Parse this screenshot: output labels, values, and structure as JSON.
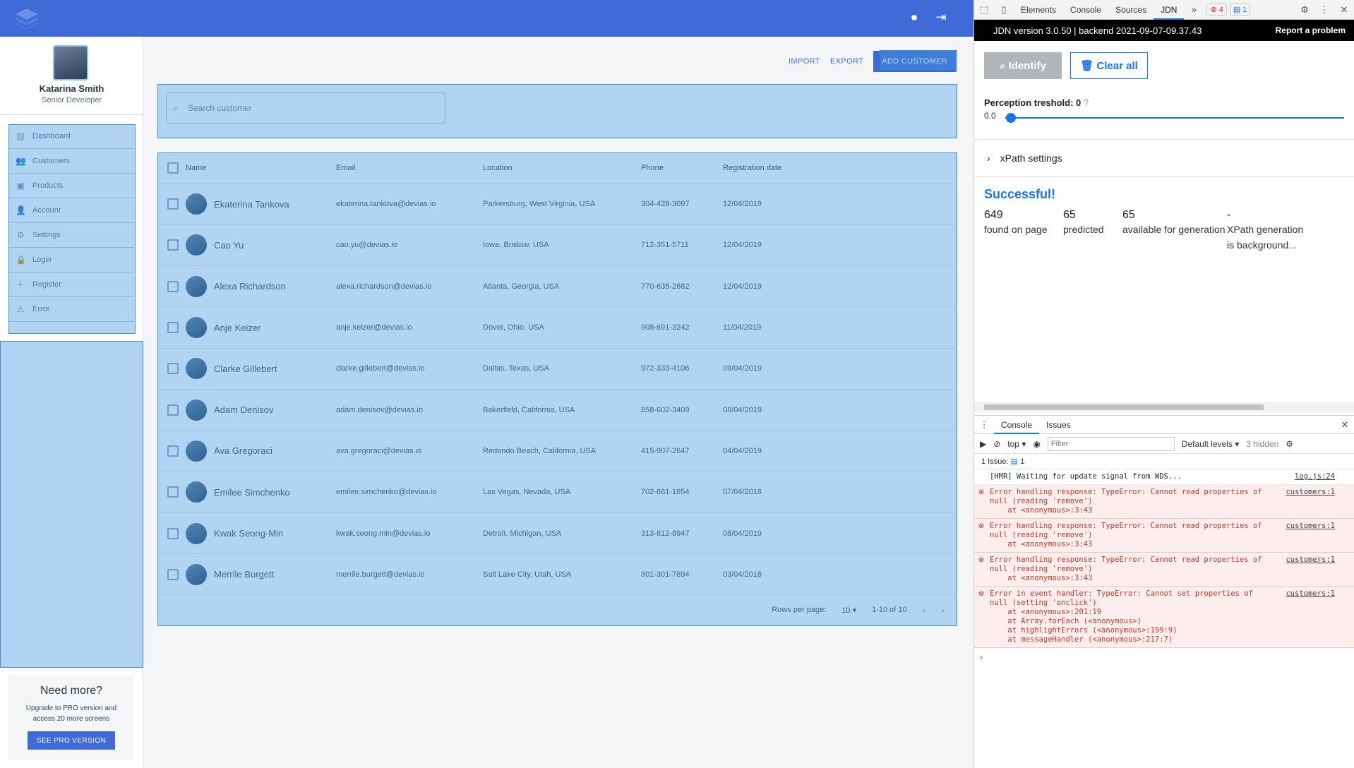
{
  "sidebar": {
    "profile": {
      "name": "Katarina Smith",
      "role": "Senior Developer"
    },
    "items": [
      {
        "label": "Dashboard",
        "icon": "chart-icon"
      },
      {
        "label": "Customers",
        "icon": "users-icon"
      },
      {
        "label": "Products",
        "icon": "bag-icon"
      },
      {
        "label": "Account",
        "icon": "user-icon"
      },
      {
        "label": "Settings",
        "icon": "gear-icon"
      },
      {
        "label": "Login",
        "icon": "lock-icon"
      },
      {
        "label": "Register",
        "icon": "user-plus-icon"
      },
      {
        "label": "Error",
        "icon": "alert-icon"
      }
    ],
    "promo": {
      "title": "Need more?",
      "text": "Upgrade to PRO version and access 20 more screens",
      "button": "SEE PRO VERSION"
    }
  },
  "main": {
    "actions": {
      "import": "IMPORT",
      "export": "EXPORT",
      "add": "ADD CUSTOMER"
    },
    "search": {
      "placeholder": "Search customer"
    },
    "table": {
      "headers": {
        "name": "Name",
        "email": "Email",
        "location": "Location",
        "phone": "Phone",
        "date": "Registration date"
      },
      "rows": [
        {
          "name": "Ekaterina Tankova",
          "email": "ekaterina.tankova@devias.io",
          "location": "Parkersburg, West Virginia, USA",
          "phone": "304-428-3097",
          "date": "12/04/2019"
        },
        {
          "name": "Cao Yu",
          "email": "cao.yu@devias.io",
          "location": "Iowa, Bristow, USA",
          "phone": "712-351-5711",
          "date": "12/04/2019"
        },
        {
          "name": "Alexa Richardson",
          "email": "alexa.richardson@devias.io",
          "location": "Atlanta, Georgia, USA",
          "phone": "770-635-2682",
          "date": "12/04/2019"
        },
        {
          "name": "Anje Keizer",
          "email": "anje.keizer@devias.io",
          "location": "Dover, Ohio, USA",
          "phone": "908-691-3242",
          "date": "11/04/2019"
        },
        {
          "name": "Clarke Gillebert",
          "email": "clarke.gillebert@devias.io",
          "location": "Dallas, Texas, USA",
          "phone": "972-333-4106",
          "date": "09/04/2019"
        },
        {
          "name": "Adam Denisov",
          "email": "adam.denisov@devias.io",
          "location": "Bakerfield, California, USA",
          "phone": "858-602-3409",
          "date": "08/04/2019"
        },
        {
          "name": "Ava Gregoraci",
          "email": "ava.gregoraci@devias.io",
          "location": "Redondo Beach, California, USA",
          "phone": "415-907-2647",
          "date": "04/04/2019"
        },
        {
          "name": "Emilee Simchenko",
          "email": "emilee.simchenko@devias.io",
          "location": "Las Vegas, Nevada, USA",
          "phone": "702-661-1654",
          "date": "07/04/2018"
        },
        {
          "name": "Kwak Seong-Min",
          "email": "kwak.seong.min@devias.io",
          "location": "Detroit, Michigan, USA",
          "phone": "313-812-8947",
          "date": "08/04/2019"
        },
        {
          "name": "Merrile Burgett",
          "email": "merrile.burgett@devias.io",
          "location": "Salt Lake City, Utah, USA",
          "phone": "801-301-7894",
          "date": "03/04/2018"
        }
      ],
      "pagination": {
        "rows_label": "Rows per page:",
        "rows_value": "10",
        "range": "1-10 of 10"
      }
    }
  },
  "devtools": {
    "tabs": [
      "Elements",
      "Console",
      "Sources",
      "JDN"
    ],
    "error_count": "4",
    "message_count": "1",
    "jdn": {
      "version": "JDN version 3.0.50 | backend 2021-09-07-09.37.43",
      "report": "Report a problem",
      "identify": "Identify",
      "clear": "Clear all",
      "perception_label": "Perception treshold: 0",
      "perception_value": "0.0",
      "perception_fraction": 0.0,
      "xpath": "xPath settings",
      "success": "Successful!",
      "stats": [
        {
          "n": "649",
          "t": "found on page"
        },
        {
          "n": "65",
          "t": "predicted"
        },
        {
          "n": "65",
          "t": "available for generation"
        },
        {
          "n": "-",
          "t": "XPath generation is background..."
        }
      ]
    },
    "console": {
      "tabs": [
        "Console",
        "Issues"
      ],
      "context": "top",
      "filter_placeholder": "Filter",
      "levels": "Default levels",
      "hidden": "3 hidden",
      "issues": "1 Issue:",
      "issues_count": "1",
      "logs": [
        {
          "type": "info",
          "text": "[HMR] Waiting for update signal from WDS...",
          "src": "log.js:24"
        },
        {
          "type": "error",
          "text": "Error handling response: TypeError: Cannot read properties of\nnull (reading 'remove')\n    at <anonymous>:3:43",
          "src": "customers:1"
        },
        {
          "type": "error",
          "text": "Error handling response: TypeError: Cannot read properties of\nnull (reading 'remove')\n    at <anonymous>:3:43",
          "src": "customers:1"
        },
        {
          "type": "error",
          "text": "Error handling response: TypeError: Cannot read properties of\nnull (reading 'remove')\n    at <anonymous>:3:43",
          "src": "customers:1"
        },
        {
          "type": "error",
          "text": "Error in event handler: TypeError: Cannot set properties of\nnull (setting 'onclick')\n    at <anonymous>:201:19\n    at Array.forEach (<anonymous>)\n    at highlightErrors (<anonymous>:199:9)\n    at messageHandler (<anonymous>:217:7)",
          "src": "customers:1"
        }
      ]
    }
  }
}
